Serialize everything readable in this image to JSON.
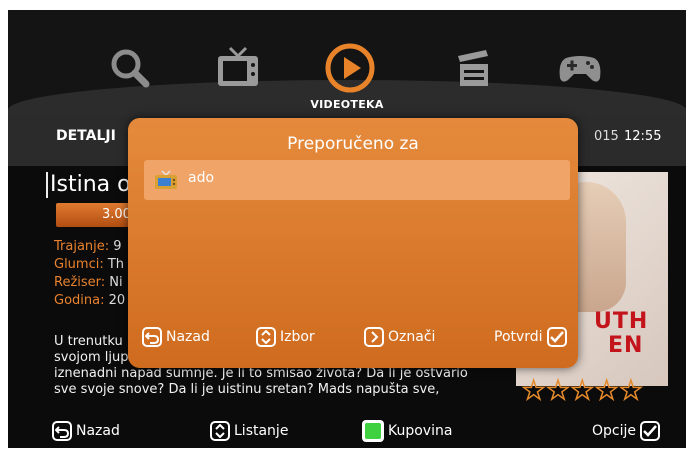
{
  "nav": {
    "title": "VIDEOTEKA",
    "icons": [
      "search-icon",
      "tv-icon",
      "play-icon",
      "clapperboard-icon",
      "gamepad-icon"
    ],
    "active_color": "#e8832a"
  },
  "header": {
    "section": "DETALJI",
    "date": "015",
    "time": "12:55"
  },
  "movie": {
    "title": "Istina o",
    "price": "3.00",
    "meta": [
      {
        "key": "Trajanje:",
        "value": " 9"
      },
      {
        "key": "Glumci:",
        "value": " Th"
      },
      {
        "key": "Režiser:",
        "value": " Ni"
      },
      {
        "key": "Godina:",
        "value": " 20"
      }
    ],
    "description_lines": [
      "U trenutku",
      "svojom ljup",
      "iznenadni napad sumnje. Je li to smisao života? Da li je ostvario",
      "sve svoje snove? Da li je uistinu sretan? Mads napušta sve,"
    ],
    "poster_text": [
      "UTH",
      "EN"
    ],
    "stars": 5
  },
  "modal": {
    "title": "Preporučeno za",
    "items": [
      {
        "label": "ado",
        "icon": "tv-icon"
      }
    ],
    "buttons": {
      "back": "Nazad",
      "select": "Izbor",
      "mark": "Označi",
      "confirm": "Potvrdi"
    }
  },
  "bottom_bar": {
    "back": "Nazad",
    "list": "Listanje",
    "buy": "Kupovina",
    "options": "Opcije"
  }
}
